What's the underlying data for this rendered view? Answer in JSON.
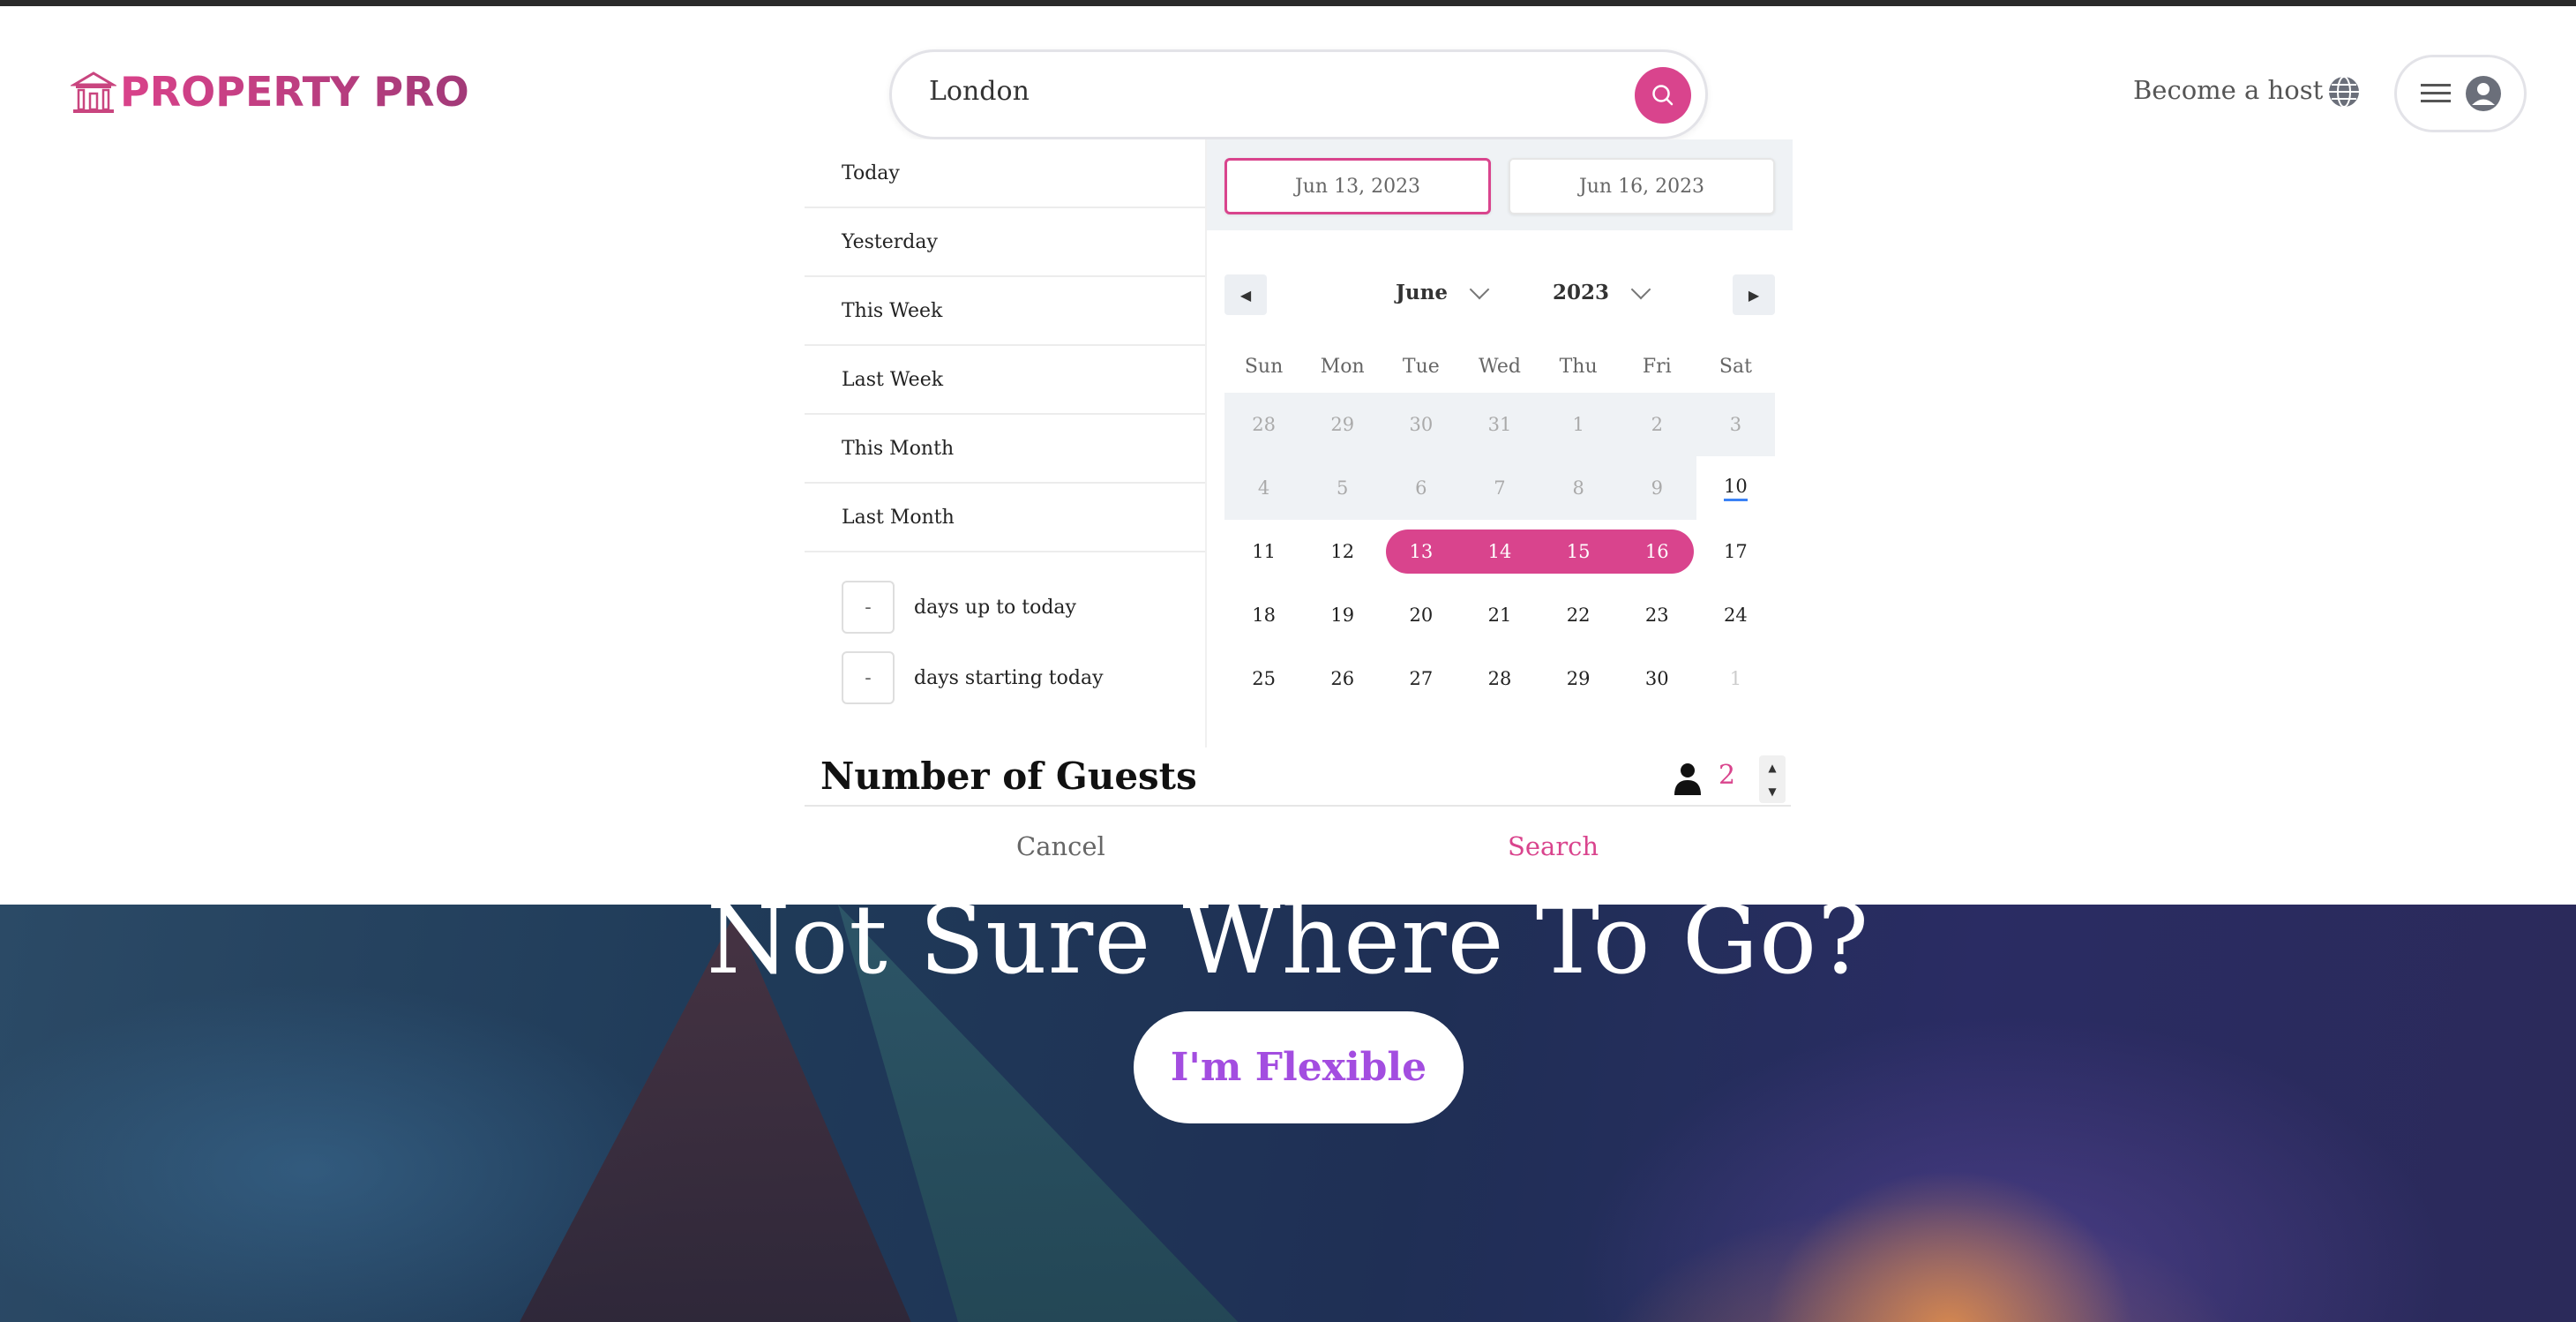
{
  "header": {
    "brand": "PROPERTY PRO",
    "search_value": "London",
    "become_host": "Become a host"
  },
  "presets": [
    "Today",
    "Yesterday",
    "This Week",
    "Last Week",
    "This Month",
    "Last Month"
  ],
  "relative": {
    "up_to_value": "-",
    "up_to_label": "days up to today",
    "starting_value": "-",
    "starting_label": "days starting today"
  },
  "calendar": {
    "start_date": "Jun 13, 2023",
    "end_date": "Jun 16, 2023",
    "month": "June",
    "year": "2023",
    "weekdays": [
      "Sun",
      "Mon",
      "Tue",
      "Wed",
      "Thu",
      "Fri",
      "Sat"
    ],
    "weeks": [
      [
        "28",
        "29",
        "30",
        "31",
        "1",
        "2",
        "3"
      ],
      [
        "4",
        "5",
        "6",
        "7",
        "8",
        "9",
        "10"
      ],
      [
        "11",
        "12",
        "13",
        "14",
        "15",
        "16",
        "17"
      ],
      [
        "18",
        "19",
        "20",
        "21",
        "22",
        "23",
        "24"
      ],
      [
        "25",
        "26",
        "27",
        "28",
        "29",
        "30",
        "1"
      ]
    ]
  },
  "guests": {
    "title": "Number of Guests",
    "count": "2"
  },
  "actions": {
    "cancel": "Cancel",
    "search": "Search"
  },
  "hero": {
    "title": "Not Sure Where To Go?",
    "button": "I'm Flexible"
  },
  "colors": {
    "accent": "#d9448d",
    "flexible_text": "#a34de0"
  }
}
